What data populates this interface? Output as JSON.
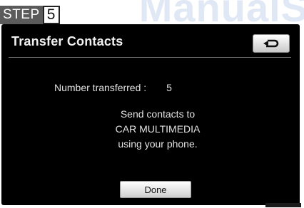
{
  "step_badge": {
    "word": "STEP",
    "number": "5"
  },
  "watermark": "ManualS",
  "screen": {
    "title": "Transfer Contacts",
    "back_icon": "return-arrow-icon",
    "count_label": "Number transferred :",
    "count_value": "5",
    "message_lines": [
      "Send contacts to",
      "CAR MULTIMEDIA",
      "using your phone."
    ],
    "done_label": "Done"
  },
  "colors": {
    "screen_bg": "#000000",
    "button_bg": "#e6e6e6",
    "step_bg": "#5b5b5b",
    "text": "#e2e2e2"
  }
}
